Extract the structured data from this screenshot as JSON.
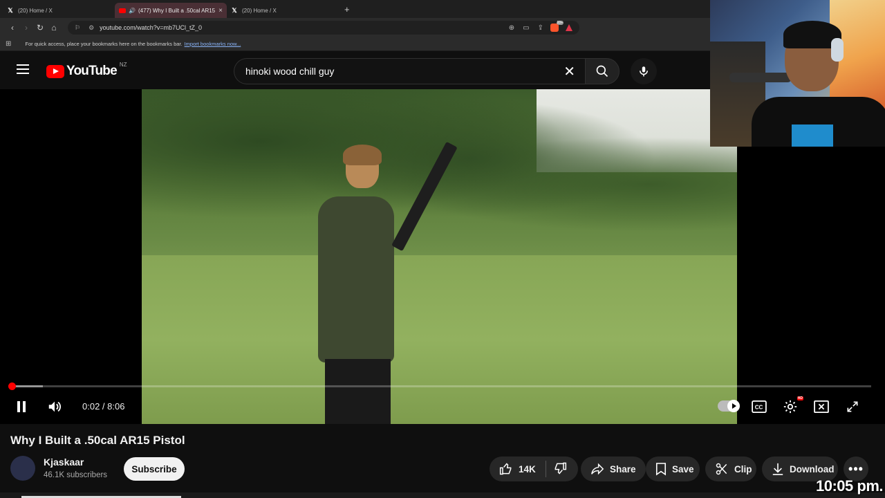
{
  "browser": {
    "tabs": [
      {
        "title": "(20) Home / X",
        "active": false,
        "icon": "x-logo-icon"
      },
      {
        "title": "(477) Why I Built a .50cal AR15 Pistol - YouTube",
        "active": true,
        "icon": "youtube-favicon-icon"
      },
      {
        "title": "(20) Home / X",
        "active": false,
        "icon": "x-logo-icon"
      }
    ],
    "new_tab": "+",
    "tab_close": "×",
    "url": "youtube.com/watch?v=mb7UCl_tZ_0",
    "brave_badge": "10+",
    "bookmarks_message": "For quick access, place your bookmarks here on the bookmarks bar.",
    "bookmarks_link": "Import bookmarks now..."
  },
  "youtube": {
    "logo_text": "YouTube",
    "country_code": "NZ",
    "search_query": "hinoki wood chill guy",
    "clear_glyph": "✕"
  },
  "player": {
    "current_time": "0:02",
    "duration": "8:06",
    "time_display": "0:02 / 8:06",
    "progress_fraction": 0.004,
    "buffered_fraction": 0.04,
    "hd_badge": "HD"
  },
  "video": {
    "title": "Why I Built a .50cal AR15 Pistol",
    "channel": "Kjaskaar",
    "subscribers": "46.1K subscribers",
    "subscribe_label": "Subscribe",
    "likes": "14K",
    "share_label": "Share",
    "save_label": "Save",
    "clip_label": "Clip",
    "download_label": "Download",
    "more_label": "•••"
  },
  "overlay": {
    "clock": "10:05 pm."
  },
  "colors": {
    "accent": "#ff0000",
    "background": "#0f0f0f",
    "pill": "#272727"
  }
}
